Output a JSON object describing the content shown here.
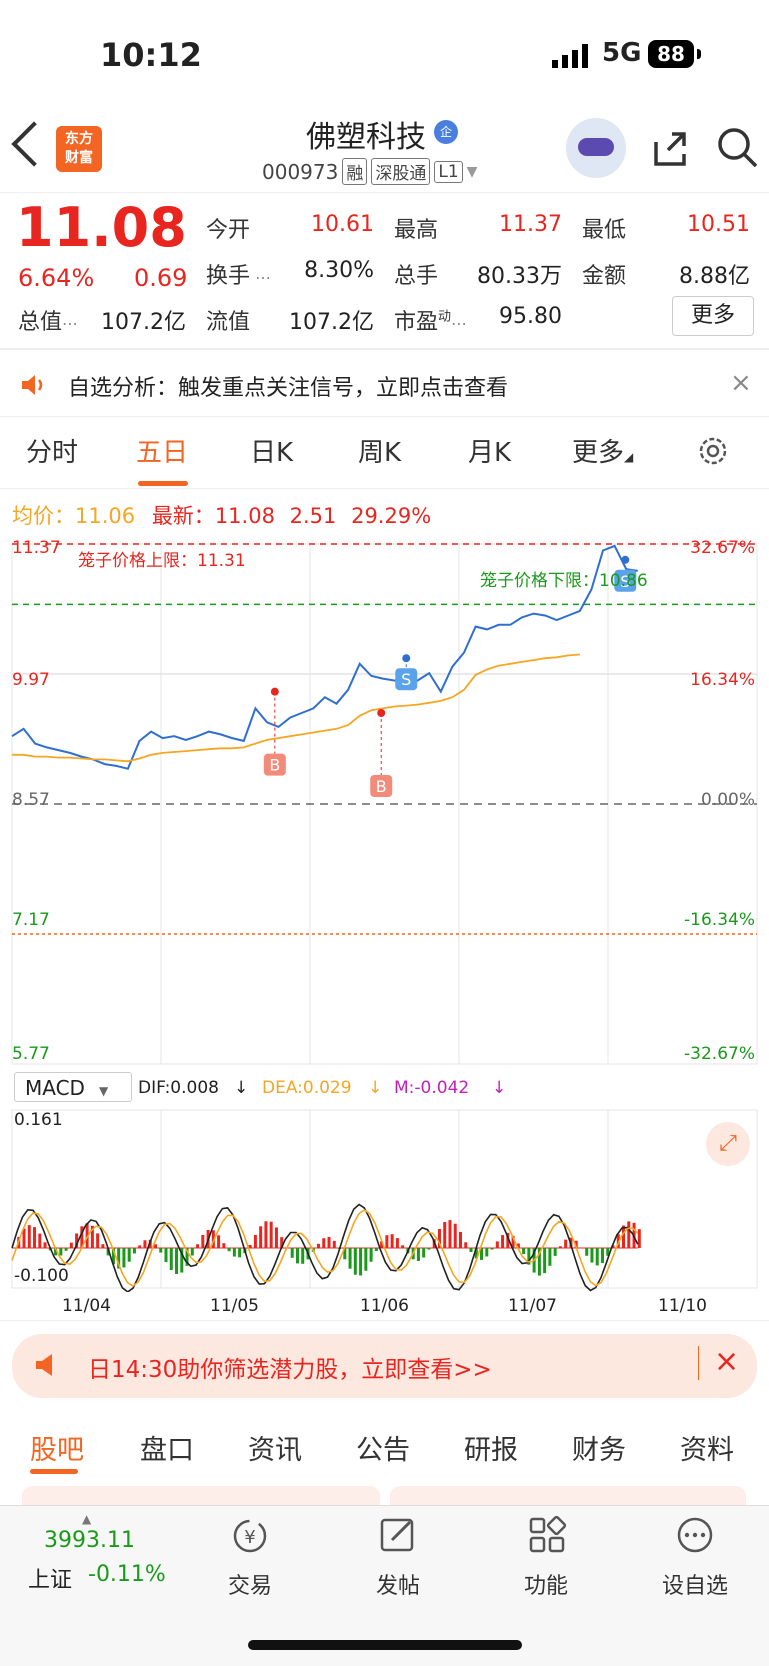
{
  "status": {
    "time": "10:12",
    "network": "5G",
    "battery": "88"
  },
  "header": {
    "name": "佛塑科技",
    "name_badge": "企",
    "code": "000973",
    "tags": [
      "融",
      "深股通",
      "L1"
    ],
    "logo": "东方\n财富",
    "icons": [
      "back-icon",
      "robot-icon",
      "share-icon",
      "search-icon"
    ]
  },
  "quote": {
    "price": "11.08",
    "change_pct": "6.64%",
    "change": "0.69",
    "fields": [
      {
        "label": "今开",
        "value": "10.61",
        "color": "red"
      },
      {
        "label": "最高",
        "value": "11.37",
        "color": "red"
      },
      {
        "label": "最低",
        "value": "10.51",
        "color": "red"
      },
      {
        "label": "换手",
        "value": "8.30%",
        "color": "dark"
      },
      {
        "label": "总手",
        "value": "80.33万",
        "color": "dark"
      },
      {
        "label": "金额",
        "value": "8.88亿",
        "color": "dark"
      },
      {
        "label": "总值",
        "value": "107.2亿",
        "color": "dark"
      },
      {
        "label": "流值",
        "value": "107.2亿",
        "color": "dark"
      },
      {
        "label": "市盈",
        "value": "95.80",
        "color": "dark",
        "sup": "动"
      }
    ],
    "more_label": "更多"
  },
  "notice": {
    "text": "自选分析：触发重点关注信号，立即点击查看"
  },
  "chart_tabs": [
    "分时",
    "五日",
    "日K",
    "周K",
    "月K",
    "更多"
  ],
  "info_line": {
    "avg_label": "均价：",
    "avg_value": "11.06",
    "latest_label": "最新：",
    "latest_value": "11.08",
    "change": "2.51",
    "pct": "29.29%"
  },
  "chart_data": {
    "type": "line",
    "y_labels_left": [
      "11.37",
      "9.97",
      "8.57",
      "7.17",
      "5.77"
    ],
    "y_labels_right": [
      "32.67%",
      "16.34%",
      "0.00%",
      "-16.34%",
      "-32.67%"
    ],
    "ylim": [
      5.77,
      11.37
    ],
    "annotations": {
      "upper_limit": "笼子价格上限：11.31",
      "lower_limit": "笼子价格下限：10.86"
    },
    "series": [
      {
        "name": "价格",
        "color": "#2f6fd0",
        "values": [
          9.3,
          9.38,
          9.22,
          9.18,
          9.15,
          9.12,
          9.08,
          9.05,
          9.0,
          8.98,
          8.95,
          9.25,
          9.35,
          9.28,
          9.3,
          9.26,
          9.3,
          9.35,
          9.32,
          9.28,
          9.25,
          9.6,
          9.45,
          9.4,
          9.5,
          9.55,
          9.6,
          9.72,
          9.65,
          9.8,
          10.08,
          9.95,
          9.92,
          9.9,
          9.88,
          9.9,
          9.98,
          9.78,
          10.05,
          10.2,
          10.48,
          10.45,
          10.5,
          10.5,
          10.58,
          10.62,
          10.6,
          10.55,
          10.6,
          10.65,
          10.88,
          11.3,
          11.35,
          11.1,
          11.08
        ]
      },
      {
        "name": "均价",
        "color": "#f5a623",
        "values": [
          9.1,
          9.1,
          9.08,
          9.08,
          9.07,
          9.07,
          9.06,
          9.05,
          9.05,
          9.04,
          9.03,
          9.06,
          9.1,
          9.12,
          9.13,
          9.14,
          9.15,
          9.16,
          9.17,
          9.17,
          9.18,
          9.22,
          9.26,
          9.28,
          9.3,
          9.32,
          9.34,
          9.36,
          9.38,
          9.42,
          9.52,
          9.58,
          9.6,
          9.62,
          9.63,
          9.64,
          9.66,
          9.68,
          9.72,
          9.8,
          9.96,
          10.02,
          10.06,
          10.08,
          10.1,
          10.12,
          10.14,
          10.15,
          10.17,
          10.18,
          null,
          null,
          null,
          null,
          null
        ]
      }
    ],
    "markers": [
      {
        "label": "B",
        "value": 9.78
      },
      {
        "label": "B",
        "value": 9.55
      },
      {
        "label": "S",
        "value": 10.14
      },
      {
        "label": "S",
        "value": 11.2
      }
    ],
    "x_labels": [
      "11/04",
      "11/05",
      "11/06",
      "11/07",
      "11/10"
    ]
  },
  "macd": {
    "selector": "MACD",
    "dif": "DIF:0.008",
    "dea": "DEA:0.029",
    "m": "M:-0.042",
    "top": "0.161",
    "bottom": "-0.100"
  },
  "ad": {
    "text": "日14:30助你筛选潜力股，立即查看>>"
  },
  "news_tabs": [
    "股吧",
    "盘口",
    "资讯",
    "公告",
    "研报",
    "财务",
    "资料"
  ],
  "bottom_nav": {
    "index_value": "3993.11",
    "index_name": "上证",
    "index_change": "-0.11%",
    "items": [
      "交易",
      "发帖",
      "功能",
      "设自选"
    ]
  }
}
